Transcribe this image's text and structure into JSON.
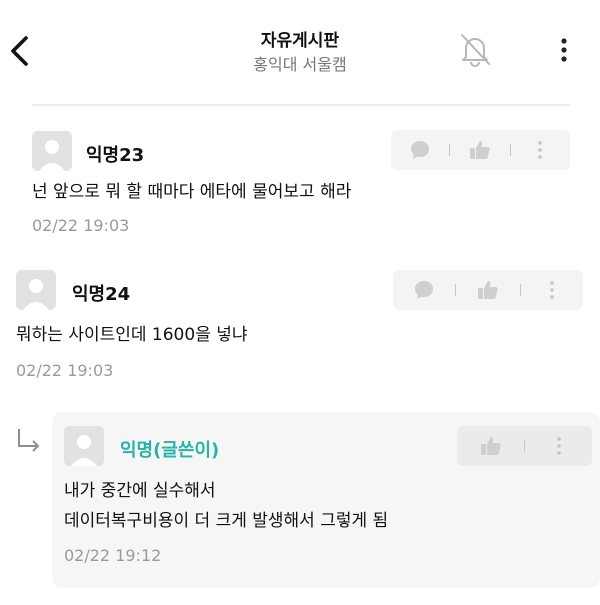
{
  "header": {
    "title": "자유게시판",
    "subtitle": "홍익대 서울캠"
  },
  "comments": [
    {
      "author": "익명23",
      "text": "넌 앞으로 뭐 할 때마다 에타에 물어보고 해라",
      "time": "02/22 19:03",
      "actions": [
        "reply-icon",
        "like-icon",
        "more-icon"
      ]
    },
    {
      "author": "익명24",
      "text": "뭐하는 사이트인데 1600을 넣냐",
      "time": "02/22 19:03",
      "actions": [
        "reply-icon",
        "like-icon",
        "more-icon"
      ]
    }
  ],
  "reply": {
    "author": "익명(글쓴이)",
    "lines": [
      "내가 중간에 실수해서",
      "데이터복구비용이 더 크게 발생해서 그렇게 됨"
    ],
    "time": "02/22 19:12",
    "actions": [
      "like-icon",
      "more-icon"
    ]
  },
  "colors": {
    "op_author": "#27b3a6",
    "muted": "#9a9a9a",
    "action_bg": "#f4f4f4",
    "reply_bg": "#f6f6f6"
  }
}
